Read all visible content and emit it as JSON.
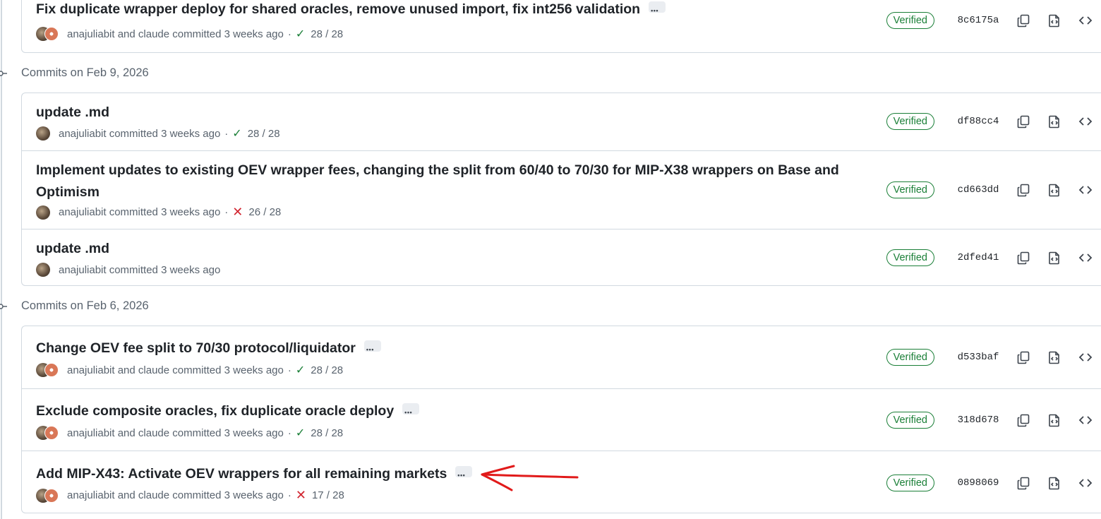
{
  "groups": [
    {
      "heading": "",
      "commits": [
        {
          "title": "Fix duplicate wrapper deploy for shared oracles, remove unused import, fix int256 validation",
          "authors": "anajuliabit and claude committed 3 weeks ago",
          "coauthored": true,
          "has_ellipsis": true,
          "status": "success",
          "checks": "28 / 28",
          "verified": "Verified",
          "sha": "8c6175a"
        }
      ]
    },
    {
      "heading": "Commits on Feb 9, 2026",
      "commits": [
        {
          "title": "update .md",
          "authors": "anajuliabit committed 3 weeks ago",
          "coauthored": false,
          "has_ellipsis": false,
          "status": "success",
          "checks": "28 / 28",
          "verified": "Verified",
          "sha": "df88cc4"
        },
        {
          "title": "Implement updates to existing OEV wrapper fees, changing the split from 60/40 to 70/30 for MIP-X38 wrappers on Base and Optimism",
          "authors": "anajuliabit committed 3 weeks ago",
          "coauthored": false,
          "has_ellipsis": false,
          "status": "failure",
          "checks": "26 / 28",
          "verified": "Verified",
          "sha": "cd663dd"
        },
        {
          "title": "update .md",
          "authors": "anajuliabit committed 3 weeks ago",
          "coauthored": false,
          "has_ellipsis": false,
          "status": "none",
          "checks": "",
          "verified": "Verified",
          "sha": "2dfed41"
        }
      ]
    },
    {
      "heading": "Commits on Feb 6, 2026",
      "commits": [
        {
          "title": "Change OEV fee split to 70/30 protocol/liquidator",
          "authors": "anajuliabit and claude committed 3 weeks ago",
          "coauthored": true,
          "has_ellipsis": true,
          "status": "success",
          "checks": "28 / 28",
          "verified": "Verified",
          "sha": "d533baf"
        },
        {
          "title": "Exclude composite oracles, fix duplicate oracle deploy",
          "authors": "anajuliabit and claude committed 3 weeks ago",
          "coauthored": true,
          "has_ellipsis": true,
          "status": "success",
          "checks": "28 / 28",
          "verified": "Verified",
          "sha": "318d678"
        },
        {
          "title": "Add MIP-X43: Activate OEV wrappers for all remaining markets",
          "authors": "anajuliabit and claude committed 3 weeks ago",
          "coauthored": true,
          "has_ellipsis": true,
          "status": "failure",
          "checks": "17 / 28",
          "verified": "Verified",
          "sha": "0898069"
        }
      ]
    }
  ],
  "icons": {
    "copy": "copy-icon",
    "browse": "file-code-icon",
    "code": "code-icon",
    "check": "check-icon",
    "x": "x-icon",
    "node": "git-commit-icon"
  },
  "colors": {
    "success": "#1a7f37",
    "failure": "#d1242f",
    "annotation": "#e11a1a",
    "border": "#d1d9e0",
    "muted": "#59636e"
  }
}
